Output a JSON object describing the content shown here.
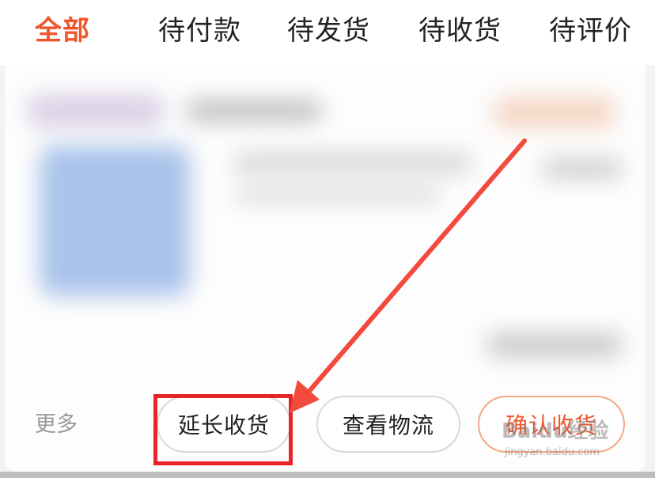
{
  "tabs": [
    "全部",
    "待付款",
    "待发货",
    "待收货",
    "待评价"
  ],
  "order_actions": {
    "more_label": "更多",
    "extend_receipt_label": "延长收货",
    "view_logistics_label": "查看物流",
    "confirm_receipt_label": "确认收货"
  },
  "watermark": {
    "brand": "Baidu经验",
    "url": "jingyan.baidu.com"
  },
  "colors": {
    "accent": "#f0562b",
    "highlight": "#e8242b",
    "arrow": "#f24b3e"
  },
  "icons": [
    "red-pointer-arrow"
  ]
}
